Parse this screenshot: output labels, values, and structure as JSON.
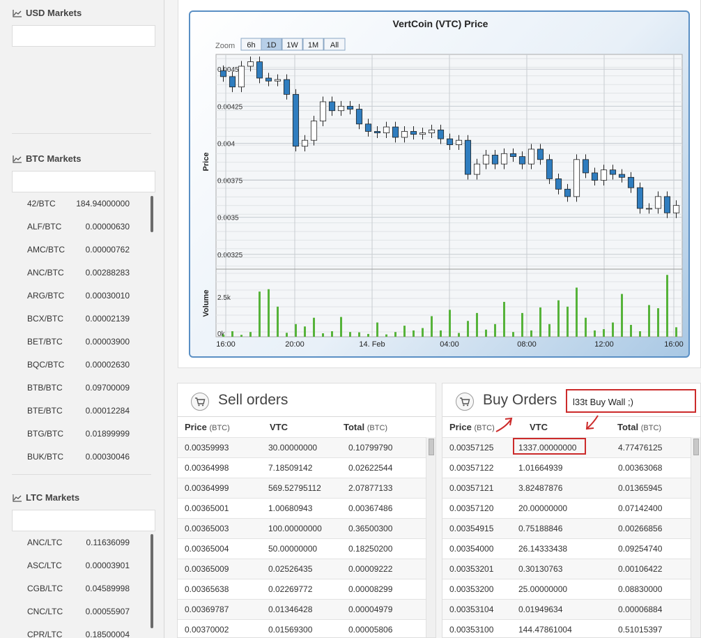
{
  "sidebar": {
    "usd": {
      "title": "USD Markets",
      "items": []
    },
    "btc": {
      "title": "BTC Markets",
      "items": [
        {
          "pair": "42/BTC",
          "value": "184.94000000"
        },
        {
          "pair": "ALF/BTC",
          "value": "0.00000630"
        },
        {
          "pair": "AMC/BTC",
          "value": "0.00000762"
        },
        {
          "pair": "ANC/BTC",
          "value": "0.00288283"
        },
        {
          "pair": "ARG/BTC",
          "value": "0.00030010"
        },
        {
          "pair": "BCX/BTC",
          "value": "0.00002139"
        },
        {
          "pair": "BET/BTC",
          "value": "0.00003900"
        },
        {
          "pair": "BQC/BTC",
          "value": "0.00002630"
        },
        {
          "pair": "BTB/BTC",
          "value": "0.09700009"
        },
        {
          "pair": "BTE/BTC",
          "value": "0.00012284"
        },
        {
          "pair": "BTG/BTC",
          "value": "0.01899999"
        },
        {
          "pair": "BUK/BTC",
          "value": "0.00030046"
        }
      ]
    },
    "ltc": {
      "title": "LTC Markets",
      "items": [
        {
          "pair": "ANC/LTC",
          "value": "0.11636099"
        },
        {
          "pair": "ASC/LTC",
          "value": "0.00003901"
        },
        {
          "pair": "CGB/LTC",
          "value": "0.04589998"
        },
        {
          "pair": "CNC/LTC",
          "value": "0.00055907"
        },
        {
          "pair": "CPR/LTC",
          "value": "0.18500004"
        }
      ]
    }
  },
  "chart": {
    "title": "VertCoin (VTC) Price",
    "zoom_label": "Zoom",
    "zoom_buttons": [
      "6h",
      "1D",
      "1W",
      "1M",
      "All"
    ],
    "zoom_selected": "1D",
    "price_label": "Price",
    "volume_label": "Volume",
    "price_ticks": [
      "0.0045",
      "0.00425",
      "0.004",
      "0.00375",
      "0.0035",
      "0.00325"
    ],
    "volume_ticks": [
      "2.5k",
      "0k"
    ],
    "x_ticks": [
      "16:00",
      "20:00",
      "14. Feb",
      "04:00",
      "08:00",
      "12:00",
      "16:00"
    ],
    "colors": {
      "up": "#ffffff",
      "down": "#2f7dbf",
      "volume": "#56b33a",
      "frame": "#5a8fc4"
    }
  },
  "chart_data": {
    "type": "candlestick",
    "title": "VertCoin (VTC) Price",
    "xlabel": "",
    "ylabel": "Price",
    "ylim": [
      0.00315,
      0.0046
    ],
    "x_ticks": [
      "16:00",
      "20:00",
      "14. Feb",
      "04:00",
      "08:00",
      "12:00",
      "16:00"
    ],
    "price_series": [
      0.00445,
      0.00438,
      0.00452,
      0.00455,
      0.00444,
      0.00442,
      0.00443,
      0.00433,
      0.00398,
      0.00402,
      0.00415,
      0.00428,
      0.00422,
      0.00425,
      0.00423,
      0.00413,
      0.00408,
      0.00407,
      0.00411,
      0.00404,
      0.00408,
      0.00406,
      0.00407,
      0.00409,
      0.00403,
      0.00399,
      0.00402,
      0.00379,
      0.00386,
      0.00392,
      0.00386,
      0.00393,
      0.00391,
      0.00386,
      0.00396,
      0.00389,
      0.00376,
      0.00369,
      0.00364,
      0.00389,
      0.0038,
      0.00375,
      0.00382,
      0.00379,
      0.00377,
      0.0037,
      0.00356,
      0.00356,
      0.00364,
      0.00353,
      0.00358
    ],
    "volume_series": [
      150,
      350,
      120,
      300,
      2850,
      3000,
      1900,
      250,
      800,
      650,
      1200,
      220,
      350,
      1250,
      300,
      280,
      180,
      900,
      150,
      300,
      700,
      400,
      550,
      1300,
      400,
      1700,
      240,
      1000,
      1500,
      450,
      800,
      2200,
      300,
      1500,
      400,
      1850,
      800,
      2300,
      1900,
      3100,
      1200,
      400,
      480,
      900,
      2700,
      750,
      350,
      2000,
      1800,
      3900,
      600
    ],
    "volume_ylim": [
      0,
      4000
    ],
    "volume_label": "Volume"
  },
  "sell": {
    "title": "Sell orders",
    "headers": {
      "price": "Price",
      "price_unit": "(BTC)",
      "vtc": "VTC",
      "total": "Total",
      "total_unit": "(BTC)"
    },
    "rows": [
      {
        "price": "0.00359993",
        "vtc": "30.00000000",
        "total": "0.10799790"
      },
      {
        "price": "0.00364998",
        "vtc": "7.18509142",
        "total": "0.02622544"
      },
      {
        "price": "0.00364999",
        "vtc": "569.52795112",
        "total": "2.07877133"
      },
      {
        "price": "0.00365001",
        "vtc": "1.00680943",
        "total": "0.00367486"
      },
      {
        "price": "0.00365003",
        "vtc": "100.00000000",
        "total": "0.36500300"
      },
      {
        "price": "0.00365004",
        "vtc": "50.00000000",
        "total": "0.18250200"
      },
      {
        "price": "0.00365009",
        "vtc": "0.02526435",
        "total": "0.00009222"
      },
      {
        "price": "0.00365638",
        "vtc": "0.02269772",
        "total": "0.00008299"
      },
      {
        "price": "0.00369787",
        "vtc": "0.01346428",
        "total": "0.00004979"
      },
      {
        "price": "0.00370002",
        "vtc": "0.01569300",
        "total": "0.00005806"
      }
    ]
  },
  "buy": {
    "title": "Buy Orders",
    "annotation": "l33t Buy Wall ;)",
    "headers": {
      "price": "Price",
      "price_unit": "(BTC)",
      "vtc": "VTC",
      "total": "Total",
      "total_unit": "(BTC)"
    },
    "rows": [
      {
        "price": "0.00357125",
        "vtc": "1337.00000000",
        "total": "4.77476125"
      },
      {
        "price": "0.00357122",
        "vtc": "1.01664939",
        "total": "0.00363068"
      },
      {
        "price": "0.00357121",
        "vtc": "3.82487876",
        "total": "0.01365945"
      },
      {
        "price": "0.00357120",
        "vtc": "20.00000000",
        "total": "0.07142400"
      },
      {
        "price": "0.00354915",
        "vtc": "0.75188846",
        "total": "0.00266856"
      },
      {
        "price": "0.00354000",
        "vtc": "26.14333438",
        "total": "0.09254740"
      },
      {
        "price": "0.00353201",
        "vtc": "0.30130763",
        "total": "0.00106422"
      },
      {
        "price": "0.00353200",
        "vtc": "25.00000000",
        "total": "0.08830000"
      },
      {
        "price": "0.00353104",
        "vtc": "0.01949634",
        "total": "0.00006884"
      },
      {
        "price": "0.00353100",
        "vtc": "144.47861004",
        "total": "0.51015397"
      }
    ]
  }
}
